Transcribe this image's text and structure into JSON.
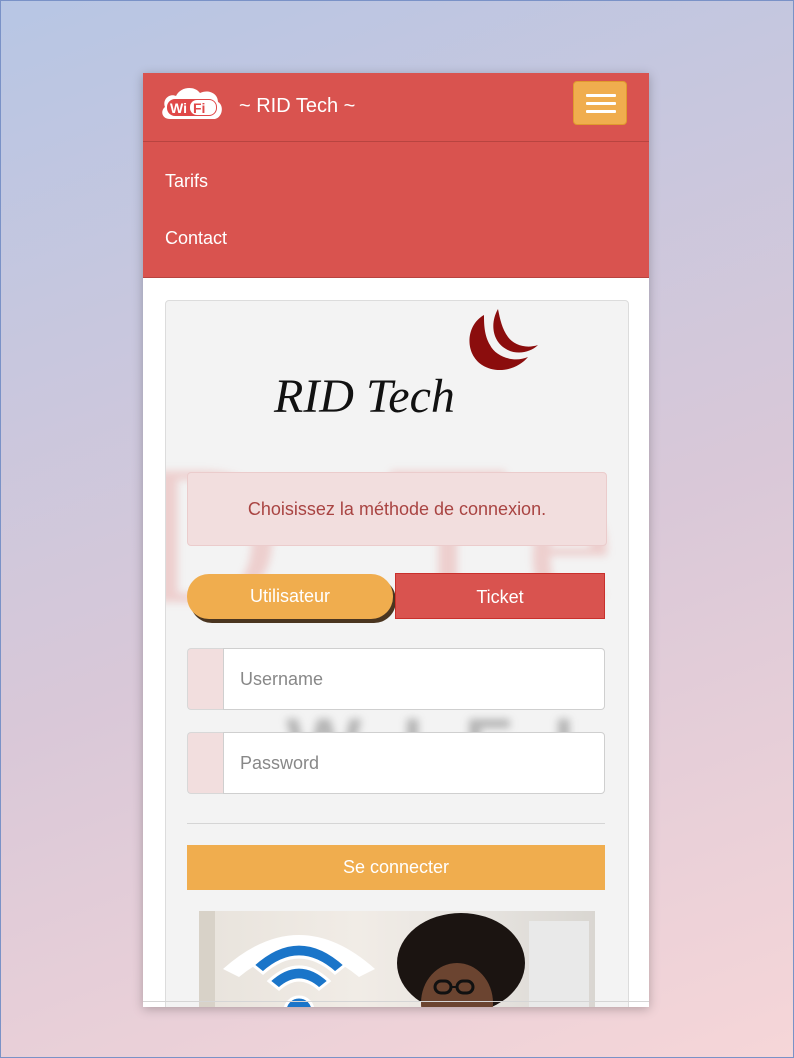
{
  "header": {
    "brand": "~ RID Tech ~",
    "logo_icon": "wifi-logo-icon",
    "menu_icon": "hamburger-icon"
  },
  "menu": {
    "items": [
      {
        "label": "Tarifs"
      },
      {
        "label": "Contact"
      }
    ]
  },
  "card": {
    "logo_text": "RID Tech",
    "alert": "Choisissez la méthode de connexion.",
    "tabs": {
      "user": "Utilisateur",
      "ticket": "Ticket"
    },
    "username_placeholder": "Username",
    "password_placeholder": "Password",
    "login_button": "Se connecter"
  },
  "colors": {
    "primary_red": "#d9534f",
    "warning_orange": "#f0ad4e",
    "alert_bg": "#f2dede",
    "alert_text": "#a94442"
  }
}
